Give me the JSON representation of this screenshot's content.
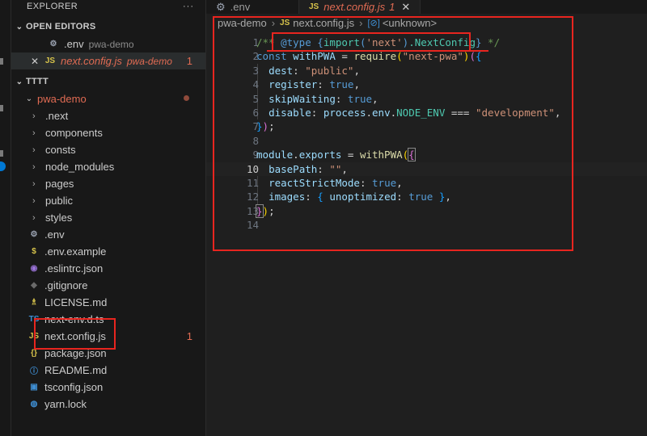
{
  "explorer": {
    "title": "EXPLORER",
    "more": "···"
  },
  "open_editors": {
    "title": "OPEN EDITORS",
    "items": [
      {
        "name": ".env",
        "folder": "pwa-demo",
        "icon": "gear-icon"
      },
      {
        "name": "next.config.js",
        "folder": "pwa-demo",
        "badge": "1",
        "icon": "js-icon"
      }
    ]
  },
  "workspace": {
    "title": "TTTT",
    "root": "pwa-demo",
    "folders": [
      ".next",
      "components",
      "consts",
      "node_modules",
      "pages",
      "public",
      "styles"
    ],
    "files": [
      {
        "name": ".env",
        "icon": "gear-icon"
      },
      {
        "name": ".env.example",
        "icon": "dollar-icon"
      },
      {
        "name": ".eslintrc.json",
        "icon": "eslint-icon"
      },
      {
        "name": ".gitignore",
        "icon": "git-icon"
      },
      {
        "name": "LICENSE.md",
        "icon": "license-icon"
      },
      {
        "name": "next-env.d.ts",
        "icon": "ts-icon"
      },
      {
        "name": "next.config.js",
        "icon": "js-icon",
        "badge": "1"
      },
      {
        "name": "package.json",
        "icon": "json-icon"
      },
      {
        "name": "README.md",
        "icon": "info-icon"
      },
      {
        "name": "tsconfig.json",
        "icon": "tsconfig-icon"
      },
      {
        "name": "yarn.lock",
        "icon": "yarn-icon"
      }
    ]
  },
  "tabs": [
    {
      "label": ".env",
      "icon": "gear-icon"
    },
    {
      "label": "next.config.js",
      "badge": "1",
      "icon": "js-icon",
      "active": true
    }
  ],
  "breadcrumb": {
    "folder": "pwa-demo",
    "file": "next.config.js",
    "symbol": "<unknown>"
  },
  "editor": {
    "current_line": 10,
    "line_numbers": [
      "1",
      "2",
      "3",
      "4",
      "5",
      "6",
      "7",
      "8",
      "9",
      "10",
      "11",
      "12",
      "13",
      "14"
    ]
  },
  "icons": {
    "js": "JS",
    "ts": "TS",
    "chevron_down": "⌄",
    "chevron_right": "›",
    "close": "✕"
  },
  "colors": {
    "accent_red": "#e8251f",
    "modified": "#e06b53",
    "js_yellow": "#d7c34b"
  }
}
